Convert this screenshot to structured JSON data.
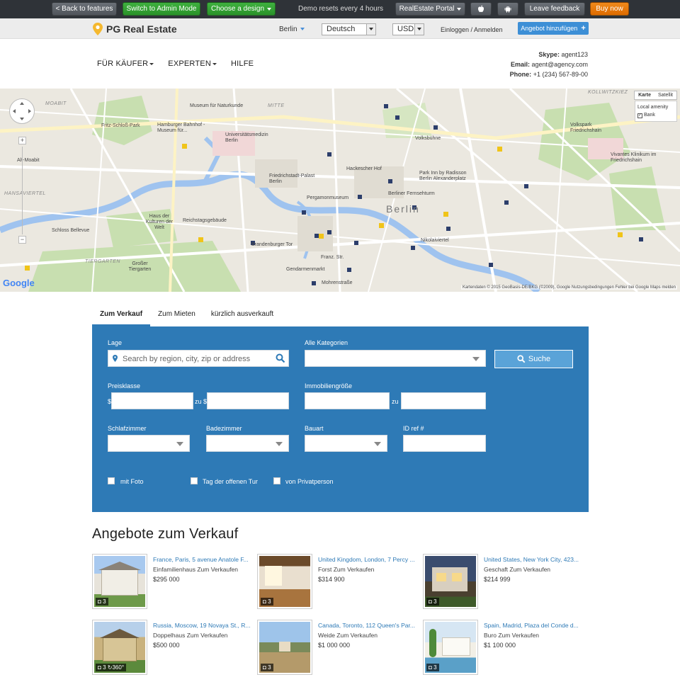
{
  "demobar": {
    "back": "< Back to features",
    "admin": "Switch to Admin Mode",
    "design": "Choose a design",
    "notice": "Demo resets every 4 hours",
    "portal": "RealEstate Portal",
    "feedback": "Leave feedback",
    "buy": "Buy now"
  },
  "topbar": {
    "brand": "PG Real Estate",
    "city": "Berlin",
    "language": "Deutsch",
    "currency": "USD",
    "login": "Einloggen / Anmelden",
    "add_listing": "Angebot hinzufügen"
  },
  "nav": [
    "FÜR KÄUFER",
    "EXPERTEN",
    "HILFE"
  ],
  "contact": {
    "skype_label": "Skype:",
    "skype": "agent123",
    "email_label": "Email:",
    "email": "agent@agency.com",
    "phone_label": "Phone:",
    "phone": "+1 (234) 567-89-00"
  },
  "map": {
    "type_map": "Karte",
    "type_sat": "Satellit",
    "layer_title": "Local amenity",
    "layer_bank": "Bank",
    "google": "Google",
    "copyright": "Kartendaten © 2015 GeoBasis-DE/BKG (©2009), Google   Nutzungsbedingungen   Fehler bei Google Maps melden",
    "city_label": "Berlin",
    "labels": [
      "MOABIT",
      "Museum für Naturkunde",
      "MITTE",
      "KOLLWITZKIEZ",
      "Fritz-Schloß-Park",
      "Hamburger Bahnhof - Museum für...",
      "Universitätsmedizin Berlin",
      "Volkspark Friedrichshain",
      "Volksbühne",
      "Alt-Moabit",
      "Hackescher Hof",
      "Friedrichstadt-Palast Berlin",
      "Park Inn by Radisson Berlin Alexanderplatz",
      "Vivantes Klinikum im Friedrichshain",
      "HANSAVIERTEL",
      "Pergamonmuseum",
      "Berliner Fernsehturm",
      "Haus der Kulturen der Welt",
      "Reichstagsgebäude",
      "Schloss Bellevue",
      "Brandenburger Tor",
      "Nikolaiviertel",
      "TIERGARTEN",
      "Großer Tiergarten",
      "Franz. Str.",
      "Gendarmenmarkt",
      "Mohrenstraße"
    ]
  },
  "tabs": [
    "Zum Verkauf",
    "Zum Mieten",
    "kürzlich ausverkauft"
  ],
  "search": {
    "location_label": "Lage",
    "location_placeholder": "Search by region, city, zip or address",
    "category_label": "Alle Kategorien",
    "submit": "Suche",
    "price_label": "Preisklasse",
    "currency_symbol": "$",
    "to_currency": "zu $",
    "size_label": "Immobiliengröße",
    "to": "zu",
    "bedrooms_label": "Schlafzimmer",
    "bathrooms_label": "Badezimmer",
    "build_label": "Bauart",
    "ref_label": "ID ref #",
    "photo_check": "mit Foto",
    "open_house_check": "Tag der offenen Tur",
    "private_check": "von Privatperson"
  },
  "offers_title": "Angebote zum Verkauf",
  "listings": [
    {
      "address": "France, Paris, 5 avenue Anatole F...",
      "type": "Einfamilienhaus Zum Verkaufen",
      "price": "$295 000",
      "photos": "3",
      "extra": ""
    },
    {
      "address": "United Kingdom, London, 7 Percy ...",
      "type": "Forst Zum Verkaufen",
      "price": "$314 900",
      "photos": "3",
      "extra": ""
    },
    {
      "address": "United States, New York City, 423...",
      "type": "Geschaft Zum Verkaufen",
      "price": "$214 999",
      "photos": "3",
      "extra": ""
    },
    {
      "address": "Russia, Moscow, 19 Novaya St., R...",
      "type": "Doppelhaus Zum Verkaufen",
      "price": "$500 000",
      "photos": "3",
      "extra": "360°"
    },
    {
      "address": "Canada, Toronto, 112 Queen's Par...",
      "type": "Weide Zum Verkaufen",
      "price": "$1 000 000",
      "photos": "3",
      "extra": ""
    },
    {
      "address": "Spain, Madrid, Plaza del Conde d...",
      "type": "Buro Zum Verkaufen",
      "price": "$1 100 000",
      "photos": "3",
      "extra": ""
    }
  ]
}
